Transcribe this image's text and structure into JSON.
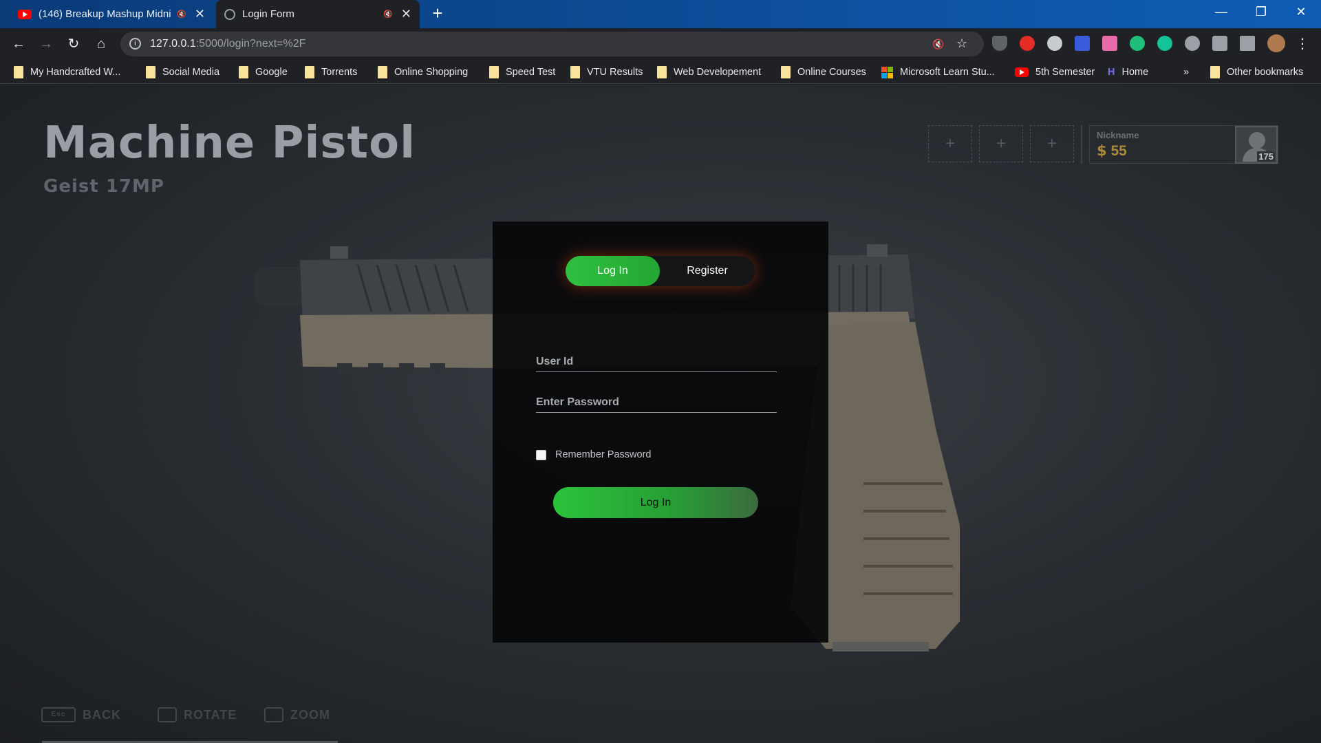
{
  "browser": {
    "tabs": [
      {
        "title": "(146) Breakup Mashup Midni",
        "favicon": "youtube-icon"
      },
      {
        "title": "Login Form",
        "favicon": "globe-icon"
      }
    ],
    "url_host": "127.0.0.1",
    "url_path": ":5000/login?next=%2F",
    "bookmarks": [
      "My Handcrafted W...",
      "Social Media",
      "Google",
      "Torrents",
      "Online Shopping",
      "Speed Test",
      "VTU Results",
      "Web Developement",
      "Online Courses",
      "Microsoft Learn Stu...",
      "5th Semester",
      "Home"
    ],
    "overflow_label": "»",
    "other_bookmarks": "Other bookmarks"
  },
  "game": {
    "weapon_class": "Machine Pistol",
    "weapon_name": "Geist 17MP",
    "nickname_label": "Nickname",
    "credits": "55",
    "level": "175",
    "hints": {
      "back": "BACK",
      "rotate": "ROTATE",
      "zoom": "ZOOM",
      "back_key": "Esc"
    }
  },
  "login": {
    "tab_login": "Log In",
    "tab_register": "Register",
    "user_placeholder": "User Id",
    "password_placeholder": "Enter Password",
    "remember_label": "Remember Password",
    "submit_label": "Log In"
  },
  "colors": {
    "accent_green": "#2fc03f",
    "glow_orange": "#c84614",
    "credits_gold": "#a98a3a"
  }
}
